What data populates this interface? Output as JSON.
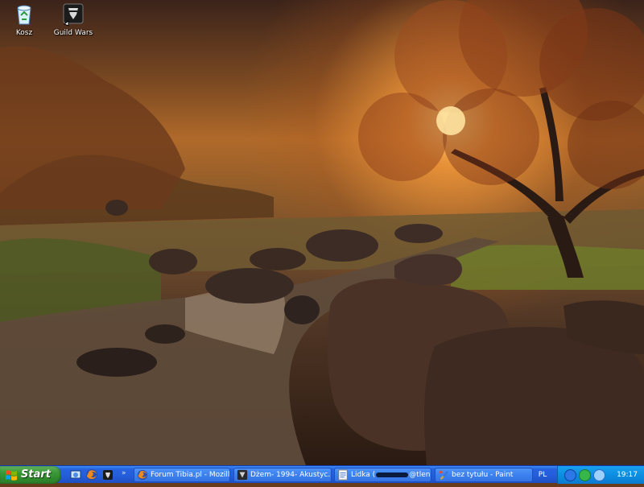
{
  "desktop": {
    "icons": [
      {
        "label": "Kosz",
        "icon": "recycle-bin-icon"
      },
      {
        "label": "Guild Wars",
        "icon": "guild-wars-icon"
      }
    ]
  },
  "taskbar": {
    "start_label": "Start",
    "tasks": [
      {
        "label": "Forum Tibia.pl - Mozill...",
        "icon": "firefox-icon"
      },
      {
        "label": "Dżem- 1994- Akustyc...",
        "icon": "winamp-icon"
      },
      {
        "label_prefix": "Lidka (",
        "label_suffix": "@tlen....",
        "icon": "tlen-icon"
      },
      {
        "label": "bez tytułu - Paint",
        "icon": "paint-icon"
      }
    ],
    "language": "PL",
    "clock": "19:17"
  },
  "colors": {
    "taskbar_blue": "#245edb",
    "start_green": "#3c9a39",
    "tray_blue": "#0d8ce0"
  }
}
